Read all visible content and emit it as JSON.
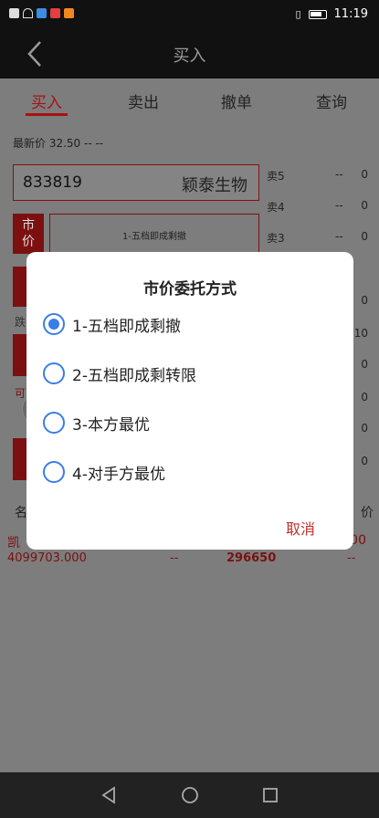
{
  "status_bar": {
    "time": "11:19"
  },
  "nav": {
    "title": "买入"
  },
  "tabs": [
    "买入",
    "卖出",
    "撤单",
    "查询"
  ],
  "price_line": "最新价 32.50 -- --",
  "stock": {
    "code": "833819",
    "name": "颖泰生物"
  },
  "market_tag": "市\n价",
  "market_box_text": "1-五档即成剩撤",
  "left_labels": {
    "fall": "跌",
    "available": "可"
  },
  "orderbook": [
    {
      "level": "卖5",
      "price": "--",
      "volume": "0"
    },
    {
      "level": "卖4",
      "price": "--",
      "volume": "0"
    },
    {
      "level": "卖3",
      "price": "--",
      "volume": "0"
    }
  ],
  "orderbook_right_values": [
    "0",
    "10",
    "0",
    "0",
    "0",
    "0"
  ],
  "list": {
    "header_left": "名",
    "header_right": "价",
    "row": {
      "name": "凯",
      "number": "4099703.000",
      "dash1": "--",
      "value": "296650",
      "dash2": "--",
      "right": "00"
    }
  },
  "dialog": {
    "title": "市价委托方式",
    "options": [
      {
        "label": "1-五档即成剩撤",
        "checked": true
      },
      {
        "label": "2-五档即成剩转限",
        "checked": false
      },
      {
        "label": "3-本方最优",
        "checked": false
      },
      {
        "label": "4-对手方最优",
        "checked": false
      }
    ],
    "cancel_label": "取消"
  },
  "colors": {
    "accent_red": "#c0302a",
    "radio_blue": "#3a7de6",
    "dark_red": "#7c1010"
  }
}
